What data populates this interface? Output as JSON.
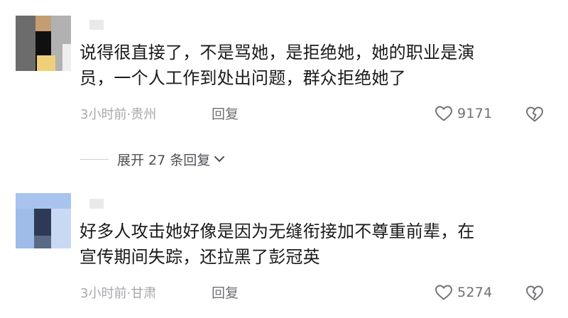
{
  "comments": [
    {
      "text_lines": [
        "说得很直接了，不是骂她，是拒绝她，她的职业是演",
        "员，一个人工作到处出问题，群众拒绝她了"
      ],
      "time": "3小时前",
      "separator": "·",
      "location": "贵州",
      "reply_label": "回复",
      "likes": "9171"
    },
    {
      "text_lines": [
        "好多人攻击她好像是因为无缝衔接加不尊重前辈，在",
        "宣传期间失踪，还拉黑了彭冠英"
      ],
      "time": "3小时前",
      "separator": "·",
      "location": "甘肃",
      "reply_label": "回复",
      "likes": "5274"
    }
  ],
  "expand": {
    "label": "展开 27 条回复"
  },
  "colors": {
    "text": "#1a1a1a",
    "meta": "#a7a7ad",
    "icon": "#6f6f75"
  },
  "icons": {
    "like": "heart-outline-icon",
    "dislike": "broken-heart-icon",
    "expand": "chevron-down-icon"
  }
}
